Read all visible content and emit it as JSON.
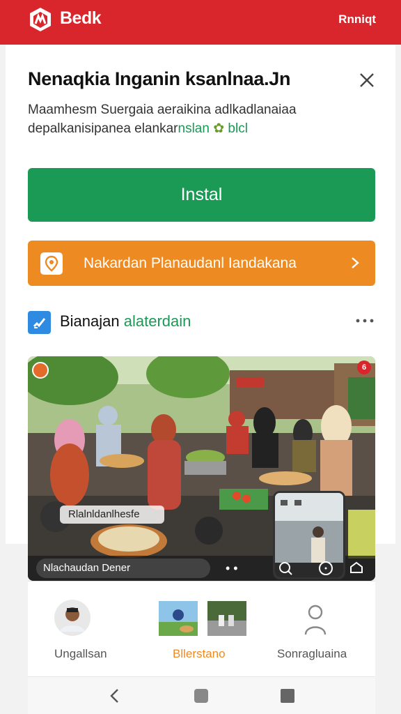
{
  "topbar": {
    "brand": "Bedk",
    "right_label": "Rnniqt"
  },
  "card": {
    "title": "Nenaqkia Inganin ksanlnaa.Jn",
    "subtitle_line1": "Maamhesm Suergaia aeraikina adlkadlanaiaa",
    "subtitle_line2_main": "depalkanisipanea elankar",
    "subtitle_line2_accent": "nslan",
    "subtitle_line2_tail": "blcl"
  },
  "install_button": {
    "label": "Instal"
  },
  "promo_button": {
    "label": "Nakardan Planaudanl Iandakana"
  },
  "section": {
    "label_main": "Bianajan",
    "label_accent": "alaterdain"
  },
  "photo": {
    "caption": "Rlalnldanlhesfe",
    "source": "Nlachaudan Dener",
    "badge_right": "6"
  },
  "bottom_nav": [
    {
      "label": "Ungallsan"
    },
    {
      "label": "Bllerstano"
    },
    {
      "label": "Sonragluaina"
    }
  ],
  "colors": {
    "brand_red": "#d9262c",
    "install_green": "#1a9a55",
    "promo_orange": "#ee8a22",
    "checkbox_blue": "#2f8be2"
  },
  "icons": [
    "brand-logo-icon",
    "close-icon",
    "location-pin-icon",
    "chevron-right-icon",
    "checkbox-icon",
    "more-dots-icon",
    "user-icon",
    "back-icon",
    "home-icon",
    "recents-icon"
  ]
}
